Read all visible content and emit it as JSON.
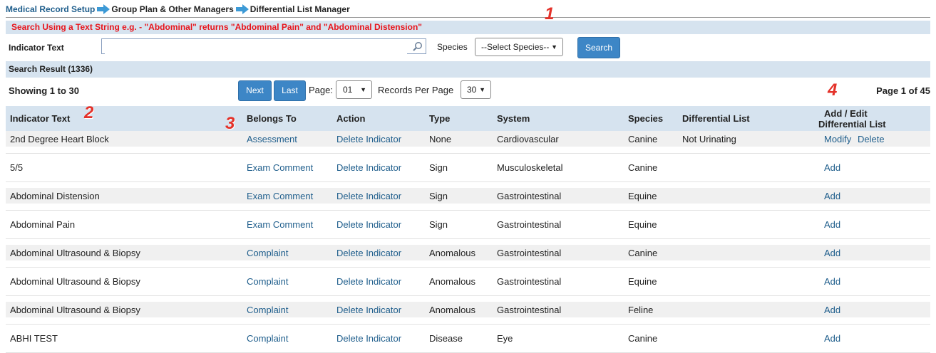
{
  "breadcrumb": {
    "items": [
      "Medical Record Setup",
      "Group Plan & Other Managers",
      "Differential List Manager"
    ]
  },
  "notice": "Search Using a Text String e.g. - \"Abdominal\" returns \"Abdominal Pain\" and \"Abdominal Distension\"",
  "search": {
    "indicator_label": "Indicator Text",
    "indicator_value": "",
    "species_label": "Species",
    "species_selected": "--Select Species--",
    "search_button": "Search"
  },
  "result_header": "Search Result (1336)",
  "pager": {
    "showing": "Showing 1 to 30",
    "next": "Next",
    "last": "Last",
    "page_label": "Page:",
    "page_selected": "01",
    "rpp_label": "Records Per Page",
    "rpp_selected": "30",
    "page_info": "Page 1 of 45"
  },
  "table": {
    "headers": {
      "indicator": "Indicator Text",
      "belongs": "Belongs To",
      "action": "Action",
      "type": "Type",
      "system": "System",
      "species": "Species",
      "differential": "Differential List",
      "add_edit_1": "Add / Edit",
      "add_edit_2": "Differential List"
    },
    "rows": [
      {
        "indicator": "2nd Degree Heart Block",
        "belongs": "Assessment",
        "action": "Delete Indicator",
        "type": "None",
        "system": "Cardiovascular",
        "species": "Canine",
        "differential": "Not Urinating",
        "op1": "Modify",
        "op2": "Delete"
      },
      {
        "indicator": "5/5",
        "belongs": "Exam Comment",
        "action": "Delete Indicator",
        "type": "Sign",
        "system": "Musculoskeletal",
        "species": "Canine",
        "differential": "",
        "op1": "Add",
        "op2": ""
      },
      {
        "indicator": "Abdominal Distension",
        "belongs": "Exam Comment",
        "action": "Delete Indicator",
        "type": "Sign",
        "system": "Gastrointestinal",
        "species": "Equine",
        "differential": "",
        "op1": "Add",
        "op2": ""
      },
      {
        "indicator": "Abdominal Pain",
        "belongs": "Exam Comment",
        "action": "Delete Indicator",
        "type": "Sign",
        "system": "Gastrointestinal",
        "species": "Equine",
        "differential": "",
        "op1": "Add",
        "op2": ""
      },
      {
        "indicator": "Abdominal Ultrasound & Biopsy",
        "belongs": "Complaint",
        "action": "Delete Indicator",
        "type": "Anomalous",
        "system": "Gastrointestinal",
        "species": "Canine",
        "differential": "",
        "op1": "Add",
        "op2": ""
      },
      {
        "indicator": "Abdominal Ultrasound & Biopsy",
        "belongs": "Complaint",
        "action": "Delete Indicator",
        "type": "Anomalous",
        "system": "Gastrointestinal",
        "species": "Equine",
        "differential": "",
        "op1": "Add",
        "op2": ""
      },
      {
        "indicator": "Abdominal Ultrasound & Biopsy",
        "belongs": "Complaint",
        "action": "Delete Indicator",
        "type": "Anomalous",
        "system": "Gastrointestinal",
        "species": "Feline",
        "differential": "",
        "op1": "Add",
        "op2": ""
      },
      {
        "indicator": "ABHI TEST",
        "belongs": "Complaint",
        "action": "Delete Indicator",
        "type": "Disease",
        "system": "Eye",
        "species": "Canine",
        "differential": "",
        "op1": "Add",
        "op2": ""
      }
    ]
  },
  "annotations": [
    "1",
    "2",
    "3",
    "4"
  ],
  "colors": {
    "accent": "#3d86c6",
    "header_bg": "#d6e3ef",
    "link": "#1f5e8c",
    "notice": "#e8141b",
    "annotation": "#e4322a"
  }
}
